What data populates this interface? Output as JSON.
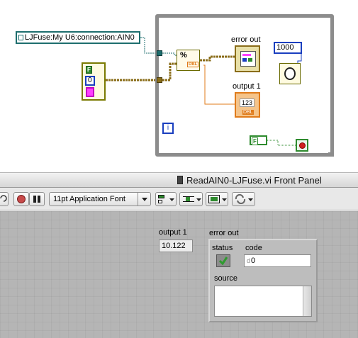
{
  "diagram": {
    "name_constant": "LJFuse:My U6:connection:AIN0",
    "cluster_const": {
      "bool_label": "F",
      "numeric_value": "0"
    },
    "loop_count_const": "1000",
    "stop_const_label": "F",
    "error_out_label": "error out",
    "output1_label": "output 1",
    "output1_terminal_text": "123",
    "output1_terminal_type": "DBL",
    "read_node_type": "DBL",
    "loop_iteration": "i"
  },
  "front_panel": {
    "window_title": "ReadAIN0-LJFuse.vi Front Panel",
    "toolbar": {
      "font_select": "11pt Application Font"
    },
    "output1": {
      "label": "output 1",
      "value": "10.122"
    },
    "error_out": {
      "label": "error out",
      "status_label": "status",
      "code_label": "code",
      "code_value": "0",
      "source_label": "source",
      "source_value": ""
    }
  },
  "colors": {
    "refnum_wire": "#1e6e6e",
    "cluster_wire": "#8a6d1a",
    "double_wire": "#e07b1a",
    "boolean_wire": "#2e8b2e",
    "loop_border": "#8c8c8c",
    "panel_bg": "#b5b5b5"
  }
}
